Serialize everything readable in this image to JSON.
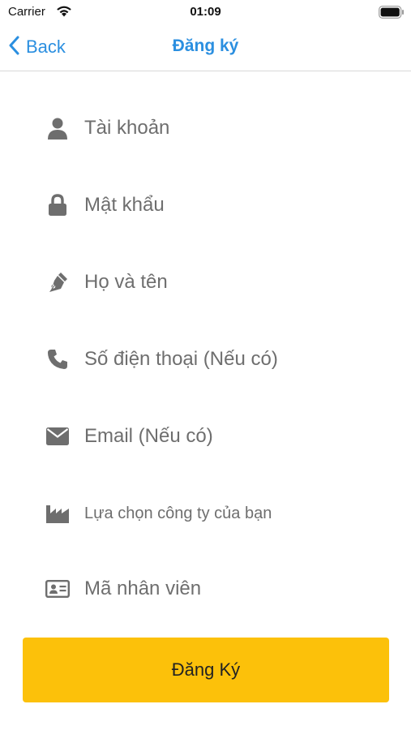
{
  "status_bar": {
    "carrier": "Carrier",
    "time": "01:09",
    "wifi_icon": "wifi-icon",
    "battery_icon": "battery-icon"
  },
  "nav": {
    "back_label": "Back",
    "back_icon": "chevron-left-icon",
    "title": "Đăng ký",
    "accent_color": "#2b8fe0"
  },
  "form": {
    "fields": [
      {
        "icon": "user-icon",
        "placeholder": "Tài khoản",
        "value": ""
      },
      {
        "icon": "lock-icon",
        "placeholder": "Mật khẩu",
        "value": ""
      },
      {
        "icon": "pen-nib-icon",
        "placeholder": "Họ và tên",
        "value": ""
      },
      {
        "icon": "phone-icon",
        "placeholder": "Số điện thoại (Nếu có)",
        "value": ""
      },
      {
        "icon": "envelope-icon",
        "placeholder": "Email (Nếu có)",
        "value": ""
      },
      {
        "icon": "industry-icon",
        "placeholder": "Lựa chọn công ty của bạn",
        "value": ""
      },
      {
        "icon": "id-card-icon",
        "placeholder": "Mã nhân viên",
        "value": ""
      }
    ]
  },
  "submit": {
    "label": "Đăng Ký",
    "color": "#fcc10a"
  }
}
